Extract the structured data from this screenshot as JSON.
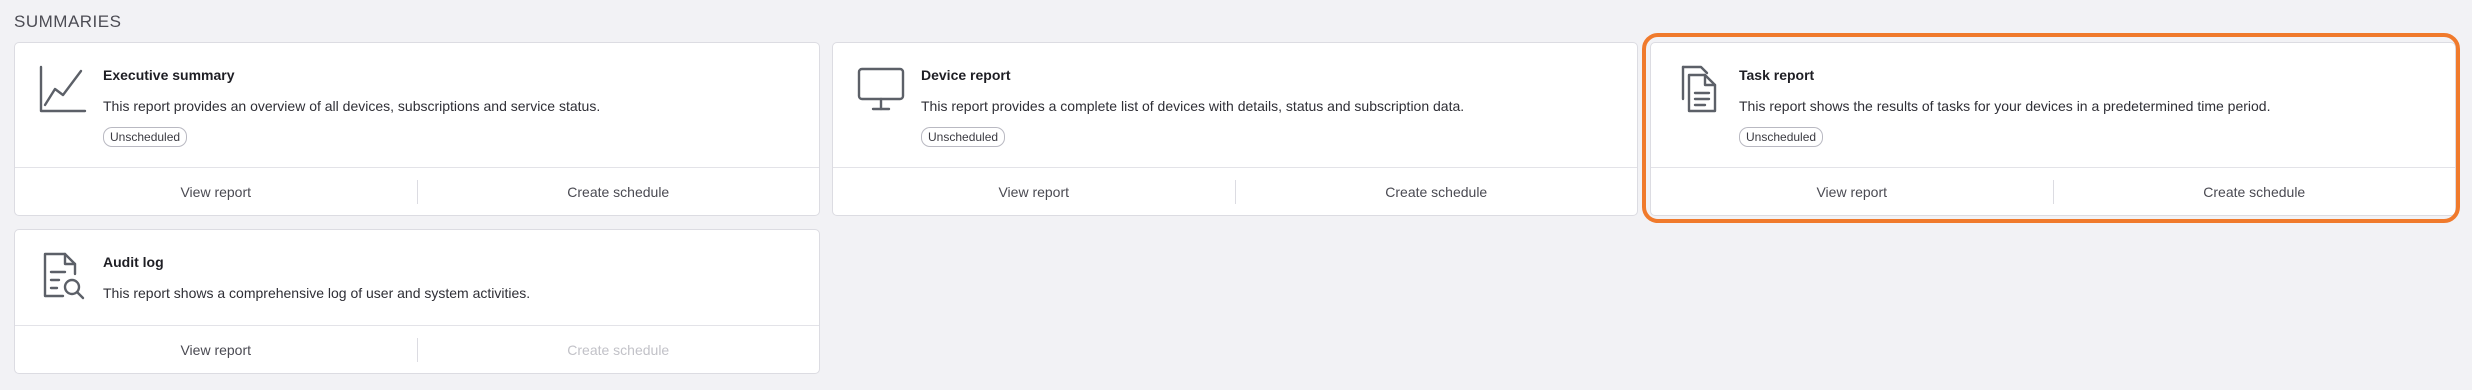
{
  "section": {
    "title": "SUMMARIES"
  },
  "cards": [
    {
      "icon": "line-chart-icon",
      "title": "Executive summary",
      "description": "This report provides an overview of all devices, subscriptions and service status.",
      "badge": "Unscheduled",
      "view_label": "View report",
      "schedule_label": "Create schedule",
      "schedule_enabled": true
    },
    {
      "icon": "monitor-icon",
      "title": "Device report",
      "description": "This report provides a complete list of devices with details, status and subscription data.",
      "badge": "Unscheduled",
      "view_label": "View report",
      "schedule_label": "Create schedule",
      "schedule_enabled": true
    },
    {
      "icon": "documents-icon",
      "title": "Task report",
      "description": "This report shows the results of tasks for your devices in a predetermined time period.",
      "badge": "Unscheduled",
      "view_label": "View report",
      "schedule_label": "Create schedule",
      "schedule_enabled": true
    },
    {
      "icon": "document-search-icon",
      "title": "Audit log",
      "description": "This report shows a comprehensive log of user and system activities.",
      "view_label": "View report",
      "schedule_label": "Create schedule",
      "schedule_enabled": false
    }
  ],
  "colors": {
    "background": "#f2f2f5",
    "card": "#ffffff",
    "icon": "#5c6068",
    "highlight": "#f07a2c",
    "disabled_text": "#c2c2c8"
  }
}
